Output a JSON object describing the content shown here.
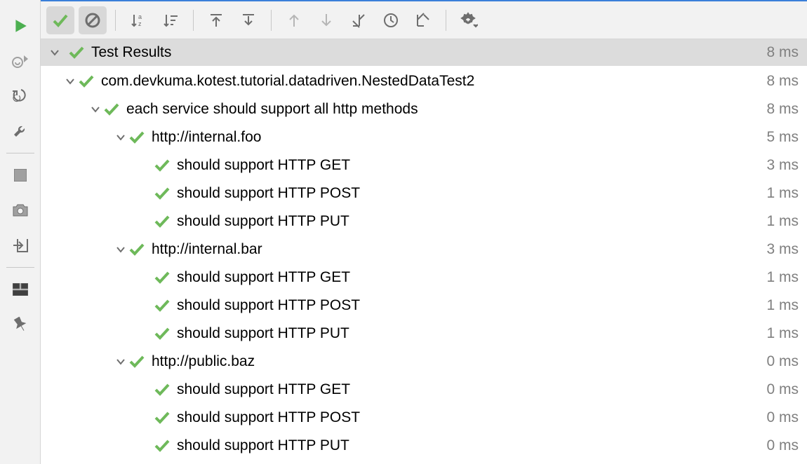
{
  "header": {
    "title": "Test Results",
    "duration": "8 ms"
  },
  "nodes": [
    {
      "depth": 0,
      "expandable": true,
      "label": "com.devkuma.kotest.tutorial.datadriven.NestedDataTest2",
      "duration": "8 ms"
    },
    {
      "depth": 1,
      "expandable": true,
      "label": "each service should support all http methods",
      "duration": "8 ms"
    },
    {
      "depth": 2,
      "expandable": true,
      "label": "http://internal.foo",
      "duration": "5 ms"
    },
    {
      "depth": 3,
      "expandable": false,
      "label": "should support HTTP GET",
      "duration": "3 ms"
    },
    {
      "depth": 3,
      "expandable": false,
      "label": "should support HTTP POST",
      "duration": "1 ms"
    },
    {
      "depth": 3,
      "expandable": false,
      "label": "should support HTTP PUT",
      "duration": "1 ms"
    },
    {
      "depth": 2,
      "expandable": true,
      "label": "http://internal.bar",
      "duration": "3 ms"
    },
    {
      "depth": 3,
      "expandable": false,
      "label": "should support HTTP GET",
      "duration": "1 ms"
    },
    {
      "depth": 3,
      "expandable": false,
      "label": "should support HTTP POST",
      "duration": "1 ms"
    },
    {
      "depth": 3,
      "expandable": false,
      "label": "should support HTTP PUT",
      "duration": "1 ms"
    },
    {
      "depth": 2,
      "expandable": true,
      "label": "http://public.baz",
      "duration": "0 ms"
    },
    {
      "depth": 3,
      "expandable": false,
      "label": "should support HTTP GET",
      "duration": "0 ms"
    },
    {
      "depth": 3,
      "expandable": false,
      "label": "should support HTTP POST",
      "duration": "0 ms"
    },
    {
      "depth": 3,
      "expandable": false,
      "label": "should support HTTP PUT",
      "duration": "0 ms"
    }
  ]
}
